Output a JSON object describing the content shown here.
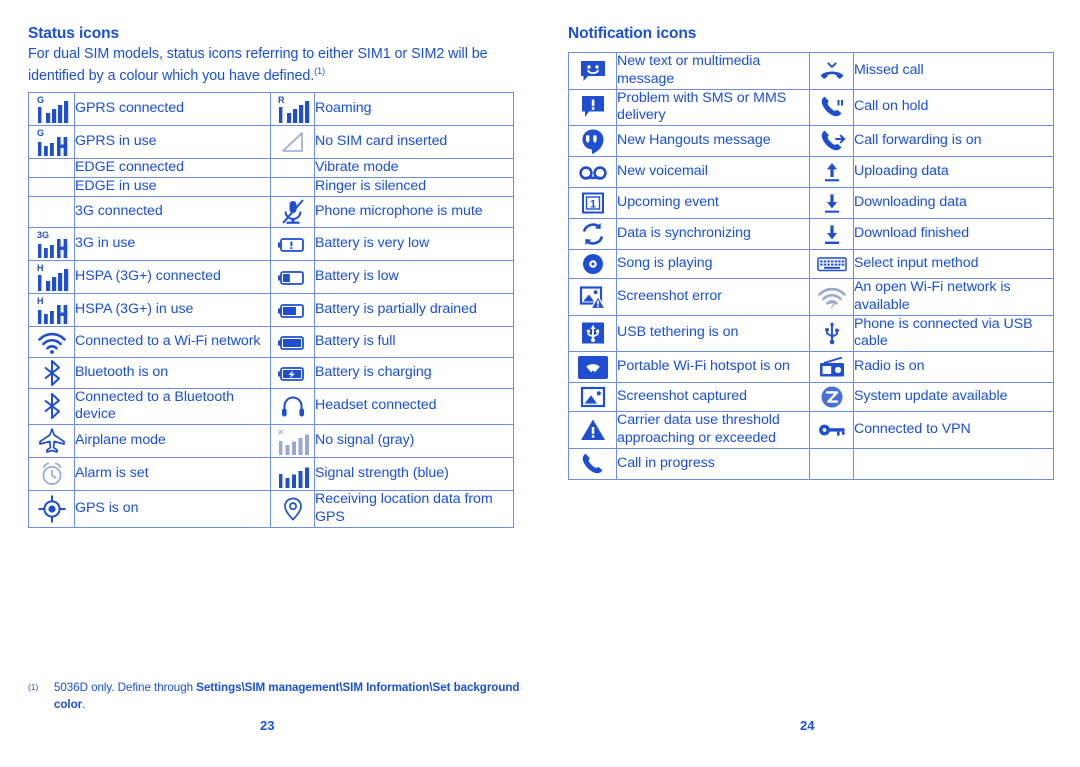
{
  "colors": {
    "text_blue": "#1a4fd8",
    "border_blue": "#6f8fdd",
    "border_outer": "#3b63c8",
    "icon_blue": "#1f4fd0",
    "icon_gray": "#9aa8cf"
  },
  "left_page": {
    "title": "Status icons",
    "intro": "For dual SIM models, status icons referring to either SIM1 or SIM2 will be identified by a colour which you have defined.",
    "intro_footnote_marker": "(1)",
    "page_number": "23",
    "footnote": {
      "marker": "(1)",
      "text_before": "5036D only. Define through ",
      "bold_path": "Settings\\SIM management\\SIM Information\\",
      "bold_path2": "Set background color",
      "text_after": "."
    },
    "rows": [
      {
        "icon_a": "gprs-connected-icon",
        "label_a": "GPRS connected",
        "icon_b": "roaming-icon",
        "label_b": "Roaming"
      },
      {
        "icon_a": "gprs-in-use-icon",
        "label_a": "GPRS in use",
        "icon_b": "no-sim-card-icon",
        "label_b": "No SIM card inserted"
      },
      {
        "icon_a": "none",
        "label_a": "EDGE connected",
        "icon_b": "none",
        "label_b": "Vibrate mode"
      },
      {
        "icon_a": "none",
        "label_a": "EDGE in use",
        "icon_b": "none",
        "label_b": "Ringer is silenced"
      },
      {
        "icon_a": "none",
        "label_a": "3G connected",
        "icon_b": "microphone-mute-icon",
        "label_b": "Phone microphone is mute"
      },
      {
        "icon_a": "3g-in-use-icon",
        "label_a": "3G in use",
        "icon_b": "battery-very-low-icon",
        "label_b": "Battery is very low"
      },
      {
        "icon_a": "hspa-connected-icon",
        "label_a": "HSPA (3G+) connected",
        "icon_b": "battery-low-icon",
        "label_b": "Battery is low"
      },
      {
        "icon_a": "hspa-in-use-icon",
        "label_a": "HSPA (3G+) in use",
        "icon_b": "battery-partially-drained-icon",
        "label_b": "Battery is partially drained"
      },
      {
        "icon_a": "wifi-connected-icon",
        "label_a": "Connected to a Wi-Fi network",
        "icon_b": "battery-full-icon",
        "label_b": "Battery is full"
      },
      {
        "icon_a": "bluetooth-on-icon",
        "label_a": "Bluetooth is on",
        "icon_b": "battery-charging-icon",
        "label_b": "Battery is charging"
      },
      {
        "icon_a": "bluetooth-connected-icon",
        "label_a": "Connected to a Bluetooth device",
        "icon_b": "headset-icon",
        "label_b": "Headset connected"
      },
      {
        "icon_a": "airplane-mode-icon",
        "label_a": "Airplane mode",
        "icon_b": "no-signal-icon",
        "label_b": "No signal (gray)"
      },
      {
        "icon_a": "alarm-icon",
        "label_a": "Alarm is set",
        "icon_b": "signal-strength-icon",
        "label_b": "Signal strength (blue)"
      },
      {
        "icon_a": "gps-on-icon",
        "label_a": "GPS is on",
        "icon_b": "location-receiving-icon",
        "label_b": "Receiving location data from GPS"
      }
    ]
  },
  "right_page": {
    "title": "Notification icons",
    "page_number": "24",
    "rows": [
      {
        "icon_a": "new-message-icon",
        "label_a": "New text or multimedia message",
        "icon_b": "missed-call-icon",
        "label_b": "Missed call"
      },
      {
        "icon_a": "message-problem-icon",
        "label_a": "Problem with SMS or MMS delivery",
        "icon_b": "call-on-hold-icon",
        "label_b": "Call on hold"
      },
      {
        "icon_a": "hangouts-icon",
        "label_a": "New Hangouts message",
        "icon_b": "call-forwarding-icon",
        "label_b": "Call forwarding is on"
      },
      {
        "icon_a": "voicemail-icon",
        "label_a": "New voicemail",
        "icon_b": "upload-icon",
        "label_b": "Uploading data"
      },
      {
        "icon_a": "calendar-event-icon",
        "label_a": "Upcoming event",
        "icon_b": "download-icon",
        "label_b": "Downloading data"
      },
      {
        "icon_a": "sync-icon",
        "label_a": "Data is synchronizing",
        "icon_b": "download-finished-icon",
        "label_b": "Download finished"
      },
      {
        "icon_a": "music-playing-icon",
        "label_a": "Song is playing",
        "icon_b": "keyboard-icon",
        "label_b": "Select input method"
      },
      {
        "icon_a": "screenshot-error-icon",
        "label_a": "Screenshot error",
        "icon_b": "open-wifi-icon",
        "label_b": "An open Wi-Fi network is available"
      },
      {
        "icon_a": "usb-tethering-icon",
        "label_a": "USB tethering is on",
        "icon_b": "usb-cable-icon",
        "label_b": "Phone is connected via USB cable"
      },
      {
        "icon_a": "wifi-hotspot-icon",
        "label_a": "Portable Wi-Fi hotspot is on",
        "icon_b": "radio-icon",
        "label_b": "Radio is on"
      },
      {
        "icon_a": "screenshot-captured-icon",
        "label_a": "Screenshot captured",
        "icon_b": "system-update-icon",
        "label_b": "System update available"
      },
      {
        "icon_a": "warning-icon",
        "label_a": "Carrier data use threshold approaching or exceeded",
        "icon_b": "vpn-key-icon",
        "label_b": "Connected to VPN"
      },
      {
        "icon_a": "call-in-progress-icon",
        "label_a": "Call in progress",
        "icon_b": "none",
        "label_b": ""
      }
    ]
  }
}
